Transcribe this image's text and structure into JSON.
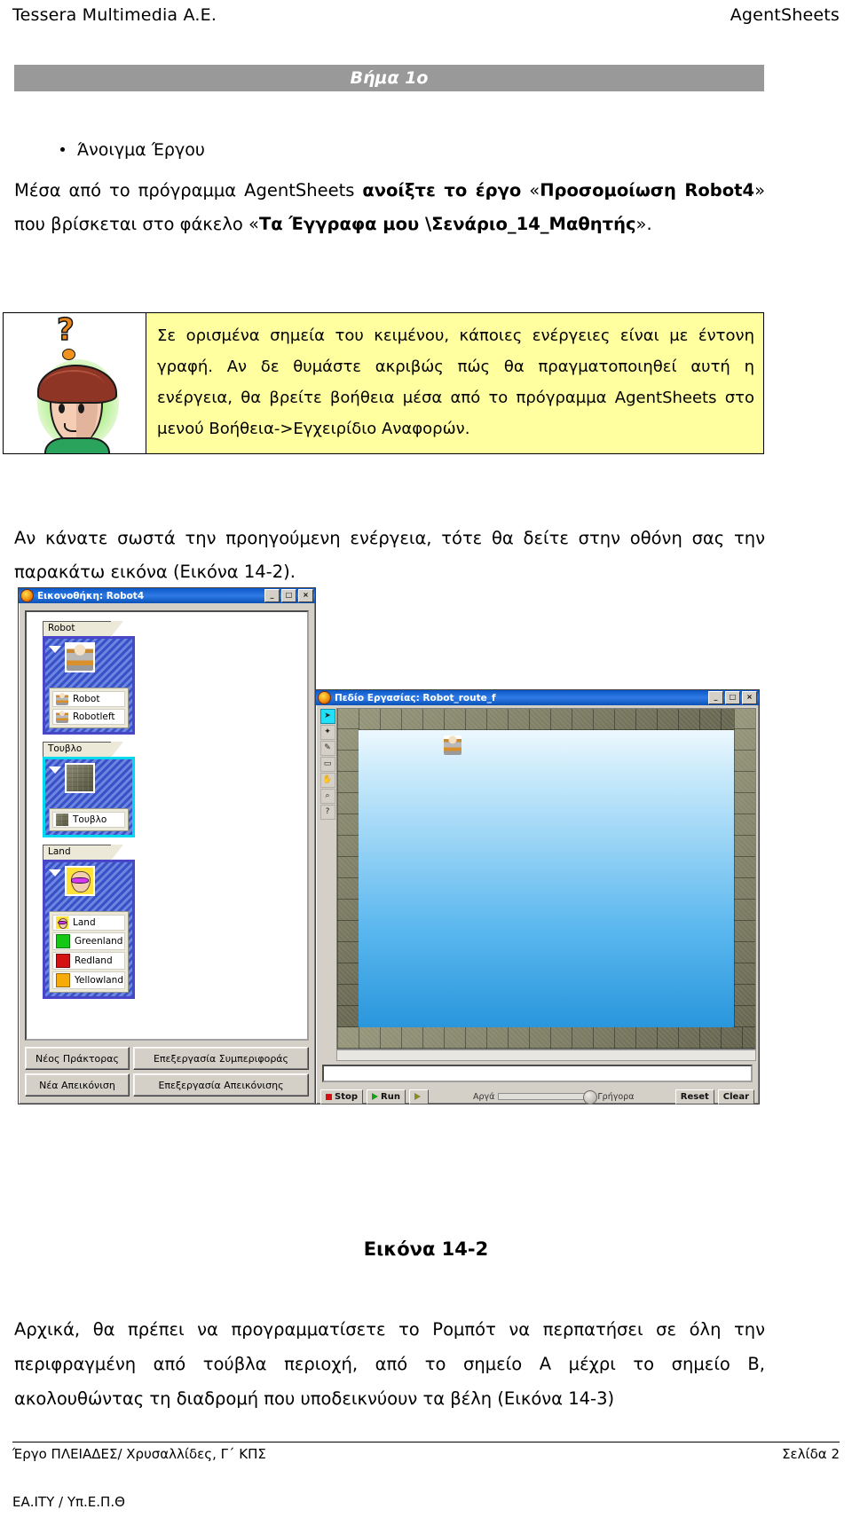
{
  "header": {
    "left": "Tessera Multimedia A.E.",
    "right": "AgentSheets"
  },
  "step_banner": {
    "label": "Βήμα 1ο"
  },
  "bullet": {
    "label": "Άνοιγμα Έργου"
  },
  "intro_paragraph": {
    "part1": "Μέσα από το πρόγραμμα AgentSheets ",
    "bold1": "ανοίξτε το έργο",
    "part2": " «",
    "bold2": "Προσομοίωση Robot4",
    "part3": "» που βρίσκεται στο φάκελο «",
    "bold3": "Τα Έγγραφα μου \\Σενάριο_14_Μαθητής",
    "part4": "»."
  },
  "tip_box": {
    "image_alt": "thinking-boy-clipart",
    "text": "Σε ορισμένα σημεία του κειμένου, κάποιες ενέργειες είναι με έντονη γραφή. Αν δε θυμάστε ακριβώς πώς θα πραγματοποιηθεί αυτή η ενέργεια, θα βρείτε βοήθεια μέσα από το πρόγραμμα AgentSheets στο μενού Βοήθεια->Εγχειρίδιο Αναφορών."
  },
  "after_tip_paragraph": {
    "text": "Αν κάνατε σωστά την προηγούμενη ενέργεια, τότε θα δείτε στην οθόνη σας την παρακάτω εικόνα (Εικόνα 14-2)."
  },
  "screenshot": {
    "gallery_window": {
      "title": "Εικονοθήκη: Robot4",
      "window_buttons": [
        "_",
        "□",
        "×"
      ],
      "groups": [
        {
          "tab": "Robot",
          "selected": false,
          "thumb": "robot-sprite",
          "items": [
            {
              "label": "Robot",
              "icon": "robot-sprite"
            },
            {
              "label": "Robotleft",
              "icon": "robot-sprite"
            }
          ]
        },
        {
          "tab": "Τουβλο",
          "selected": true,
          "thumb": "brick-sprite",
          "items": [
            {
              "label": "Τουβλο",
              "icon": "brick-sprite"
            }
          ]
        },
        {
          "tab": "Land",
          "selected": false,
          "thumb": "land-face-sprite",
          "items": [
            {
              "label": "Land",
              "icon": "land-face-sprite"
            },
            {
              "label": "Greenland",
              "icon": "green-swatch"
            },
            {
              "label": "Redland",
              "icon": "red-swatch"
            },
            {
              "label": "Yellowland",
              "icon": "yellow-swatch"
            }
          ]
        }
      ],
      "buttons": [
        "Νέος Πράκτορας",
        "Επεξεργασία Συμπεριφοράς",
        "Νέα Απεικόνιση",
        "Επεξεργασία Απεικόνισης"
      ]
    },
    "worksheet_window": {
      "title": "Πεδίο Εργασίας: Robot_route_f",
      "window_buttons": [
        "_",
        "□",
        "×"
      ],
      "tools": [
        "arrow-tool",
        "agent-tool",
        "pencil-tool",
        "eraser-tool",
        "hand-tool",
        "magnify-tool",
        "help-tool"
      ],
      "textfield_value": "",
      "controls": {
        "stop": "Stop",
        "run": "Run",
        "step": "",
        "speed_slow": "Αργά",
        "speed_fast": "Γρήγορα",
        "reset": "Reset",
        "clear": "Clear"
      }
    }
  },
  "figure_caption": {
    "label": "Εικόνα 14-2"
  },
  "closing_paragraph": {
    "text": "Αρχικά, θα πρέπει να προγραμματίσετε το Ρομπότ να περπατήσει σε όλη την περιφραγμένη από τούβλα περιοχή, από το σημείο Α μέχρι το σημείο Β, ακολουθώντας τη διαδρομή που υποδεικνύουν τα βέλη (Εικόνα 14-3)"
  },
  "footer": {
    "left": "Έργο ΠΛΕΙΑΔΕΣ/ Χρυσαλλίδες, Γ΄ ΚΠΣ",
    "right": "Σελίδα 2",
    "bottom": "ΕΑ.ΙΤΥ / Υπ.Ε.Π.Θ"
  }
}
